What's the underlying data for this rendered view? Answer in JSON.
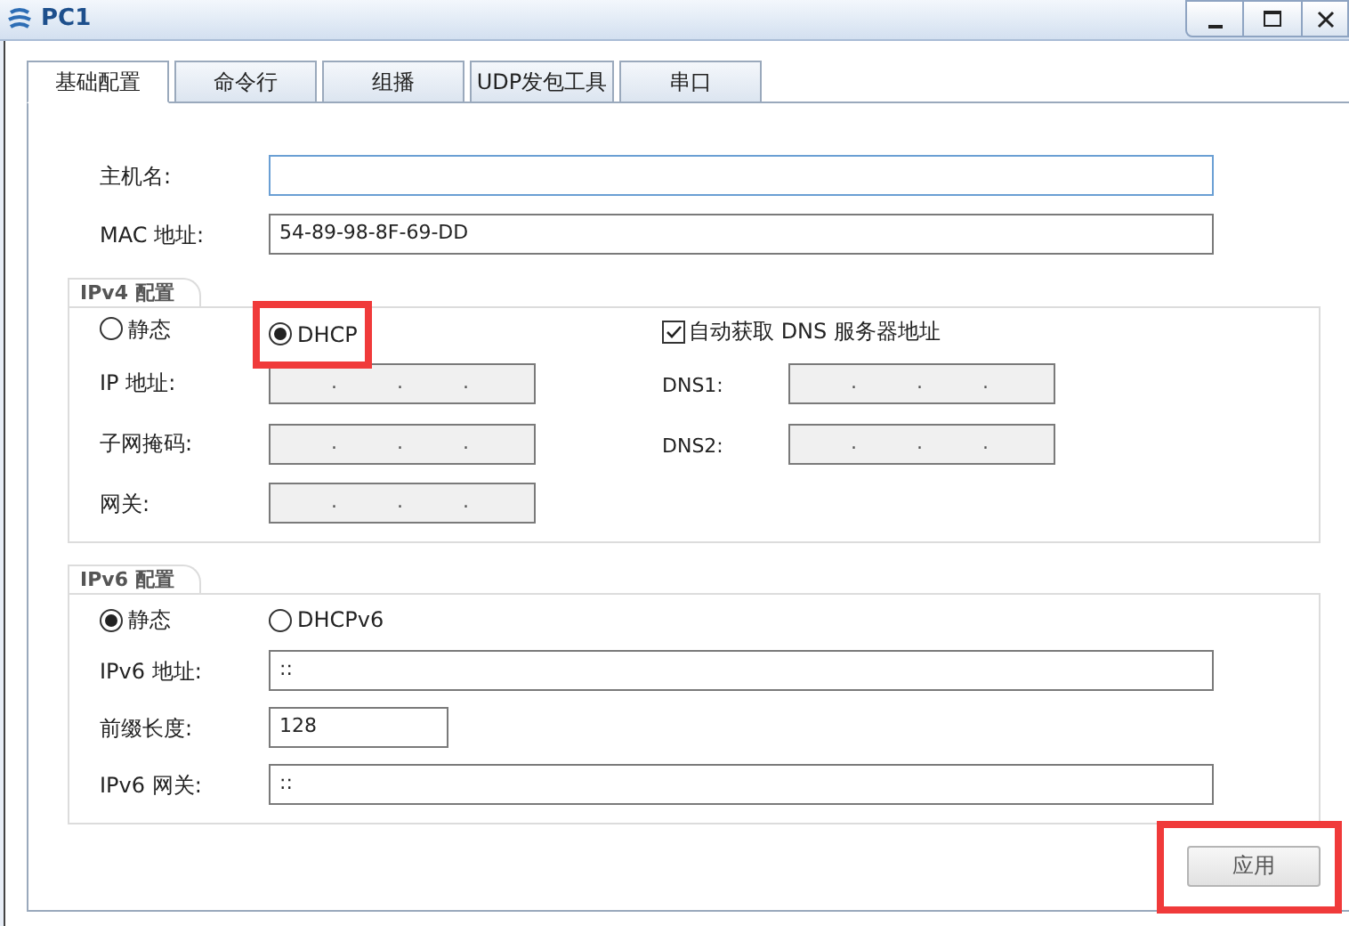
{
  "window": {
    "title": "PC1"
  },
  "tabs": [
    {
      "label": "基础配置",
      "selected": true
    },
    {
      "label": "命令行",
      "selected": false
    },
    {
      "label": "组播",
      "selected": false
    },
    {
      "label": "UDP发包工具",
      "selected": false
    },
    {
      "label": "串口",
      "selected": false
    }
  ],
  "host": {
    "label": "主机名:",
    "focused": true
  },
  "mac": {
    "label": "MAC 地址:",
    "value": "54-89-98-8F-69-DD"
  },
  "ipv4": {
    "title": "IPv4 配置",
    "modes": [
      {
        "label": "静态",
        "selected": false,
        "highlighted": false
      },
      {
        "label": "DHCP",
        "selected": true,
        "highlighted": true
      }
    ],
    "auto_dns": {
      "label": "自动获取 DNS 服务器地址",
      "checked": true
    },
    "fields": [
      {
        "label": "IP 地址:",
        "value": ". . .",
        "disabled": true
      },
      {
        "label": "子网掩码:",
        "value": ". . .",
        "disabled": true
      },
      {
        "label": "网关:",
        "value": ". . .",
        "disabled": true
      }
    ],
    "dns_fields": [
      {
        "label": "DNS1:",
        "value": ". . .",
        "disabled": true
      },
      {
        "label": "DNS2:",
        "value": ". . .",
        "disabled": true
      }
    ]
  },
  "ipv6": {
    "title": "IPv6 配置",
    "modes": [
      {
        "label": "静态",
        "selected": true
      },
      {
        "label": "DHCPv6",
        "selected": false
      }
    ],
    "fields": [
      {
        "label": "IPv6 地址:",
        "value": "::",
        "kind": "long"
      },
      {
        "label": "前缀长度:",
        "value": "128",
        "kind": "short"
      },
      {
        "label": "IPv6 网关:",
        "value": "::",
        "kind": "long"
      }
    ]
  },
  "apply": {
    "label": "应用",
    "highlighted": true
  }
}
